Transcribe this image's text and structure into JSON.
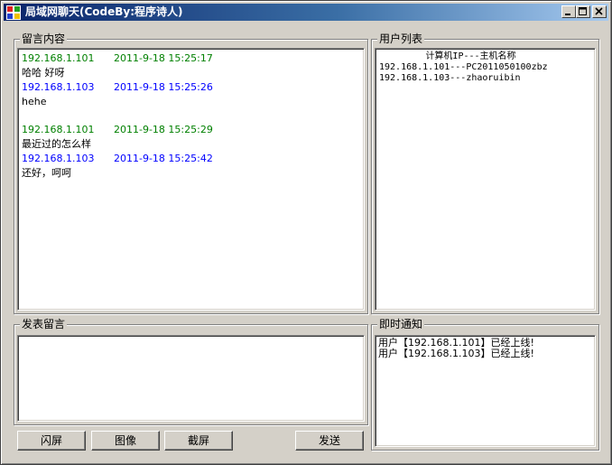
{
  "window": {
    "title": "局域网聊天(CodeBy:程序诗人)"
  },
  "messages_group": {
    "label": "留言内容",
    "messages": [
      {
        "ip": "192.168.1.101",
        "time": "2011-9-18 15:25:17",
        "text": "哈哈 好呀",
        "color": "#008000"
      },
      {
        "ip": "192.168.1.103",
        "time": "2011-9-18 15:25:26",
        "text": "hehe",
        "color": "#0000ff"
      },
      {
        "ip": "192.168.1.101",
        "time": "2011-9-18 15:25:29",
        "text": "最近过的怎么样",
        "color": "#008000"
      },
      {
        "ip": "192.168.1.103",
        "time": "2011-9-18 15:25:42",
        "text": "还好，呵呵",
        "color": "#0000ff"
      }
    ]
  },
  "users_group": {
    "label": "用户列表",
    "header": "计算机IP---主机名称",
    "users": [
      "192.168.1.101---PC2011050100zbz",
      "192.168.1.103---zhaoruibin"
    ]
  },
  "compose_group": {
    "label": "发表留言",
    "value": ""
  },
  "notice_group": {
    "label": "即时通知",
    "notices": [
      "用户【192.168.1.101】已经上线!",
      "用户【192.168.1.103】已经上线!"
    ]
  },
  "buttons": {
    "shake": "闪屏",
    "image": "图像",
    "screenshot": "截屏",
    "send": "发送"
  }
}
